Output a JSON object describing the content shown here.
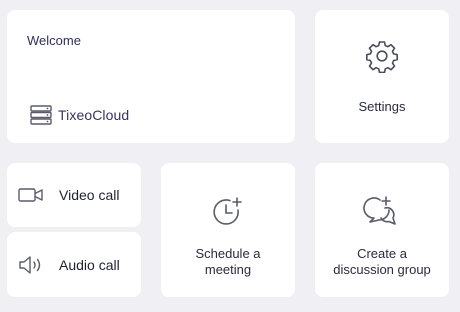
{
  "welcome": {
    "title": "Welcome",
    "brand_name": "TixeoCloud",
    "brand_icon": "server-icon"
  },
  "settings": {
    "label": "Settings",
    "icon": "gear-icon"
  },
  "calls": {
    "video_label": "Video call",
    "video_icon": "video-camera-icon",
    "audio_label": "Audio call",
    "audio_icon": "speaker-icon"
  },
  "schedule": {
    "label_line1": "Schedule a",
    "label_line2": "meeting",
    "icon": "clock-add-icon"
  },
  "discussion": {
    "label_line1": "Create a",
    "label_line2": "discussion group",
    "icon": "chat-add-icon"
  },
  "colors": {
    "background": "#efeff4",
    "card": "#ffffff",
    "icon": "#5a5b6b",
    "text": "#2a2b3d"
  }
}
